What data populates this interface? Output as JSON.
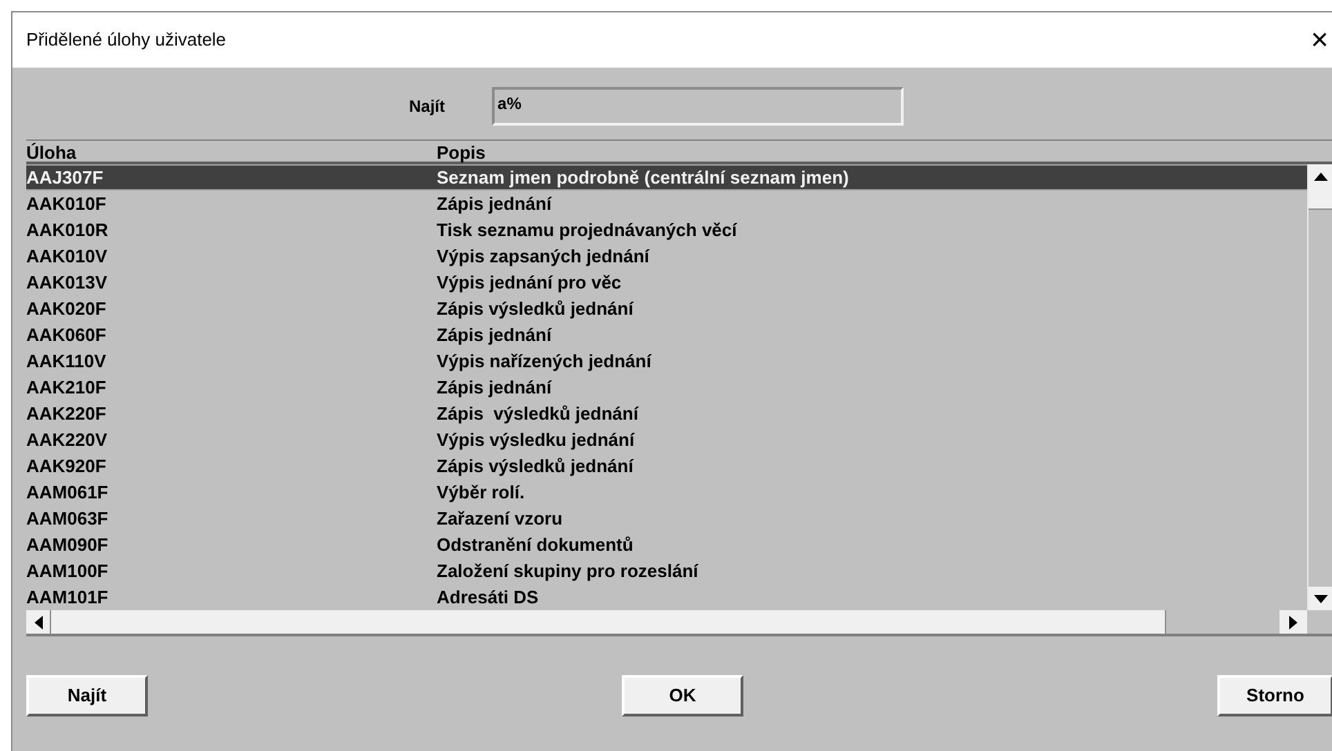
{
  "window": {
    "title": "Přidělené úlohy uživatele",
    "close": "×"
  },
  "search": {
    "label": "Najít",
    "value": "a%"
  },
  "table": {
    "columns": [
      "Úloha",
      "Popis"
    ],
    "rows": [
      {
        "code": "AAJ307F",
        "description": "Seznam jmen podrobně (centrální seznam jmen)",
        "selected": true
      },
      {
        "code": "AAK010F",
        "description": "Zápis jednání",
        "selected": false
      },
      {
        "code": "AAK010R",
        "description": "Tisk seznamu projednávaných věcí",
        "selected": false
      },
      {
        "code": "AAK010V",
        "description": "Výpis zapsaných jednání",
        "selected": false
      },
      {
        "code": "AAK013V",
        "description": "Výpis jednání pro věc",
        "selected": false
      },
      {
        "code": "AAK020F",
        "description": "Zápis výsledků jednání",
        "selected": false
      },
      {
        "code": "AAK060F",
        "description": "Zápis jednání",
        "selected": false
      },
      {
        "code": "AAK110V",
        "description": "Výpis nařízených jednání",
        "selected": false
      },
      {
        "code": "AAK210F",
        "description": "Zápis jednání",
        "selected": false
      },
      {
        "code": "AAK220F",
        "description": "Zápis  výsledků jednání",
        "selected": false
      },
      {
        "code": "AAK220V",
        "description": "Výpis výsledku jednání",
        "selected": false
      },
      {
        "code": "AAK920F",
        "description": "Zápis výsledků jednání",
        "selected": false
      },
      {
        "code": "AAM061F",
        "description": "Výběr rolí.",
        "selected": false
      },
      {
        "code": "AAM063F",
        "description": "Zařazení vzoru",
        "selected": false
      },
      {
        "code": "AAM090F",
        "description": "Odstranění dokumentů",
        "selected": false
      },
      {
        "code": "AAM100F",
        "description": "Založení skupiny pro rozeslání",
        "selected": false
      },
      {
        "code": "AAM101F",
        "description": "Adresáti DS",
        "selected": false
      }
    ]
  },
  "buttons": [
    "Najít",
    "OK",
    "Storno"
  ]
}
